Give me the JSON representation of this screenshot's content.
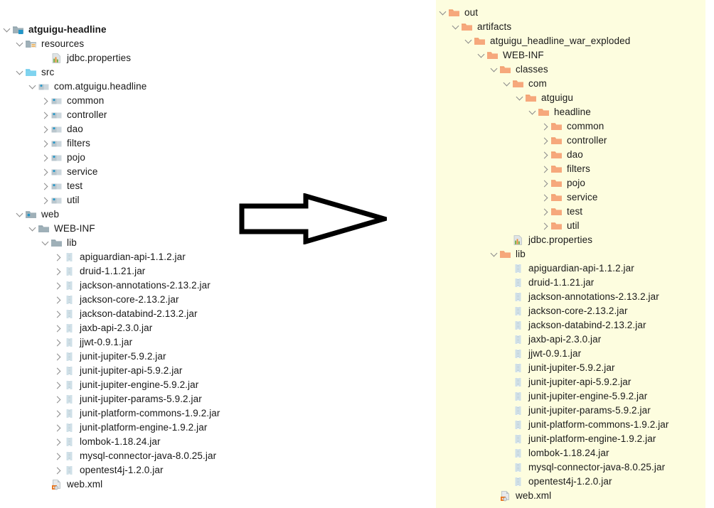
{
  "theme": {
    "left_background": "#ffffff",
    "right_background": "#fdfddf",
    "text_color": "#181818",
    "chevron_color": "#8a8a8a",
    "folder_blue": "#9aa7ad",
    "folder_cyan": "#7fd3ef",
    "folder_orange": "#f5a97a",
    "jar_icon_color": "#c6d9e2",
    "accent_blue": "#2196c9"
  },
  "arrow": {
    "name": "right-block-arrow",
    "stroke": "#000000",
    "fill": "#ffffff",
    "direction": "right"
  },
  "left_tree": {
    "name": "project-source-tree",
    "rows": [
      {
        "indent": 0,
        "chevron": "down",
        "icon": "module-icon",
        "label": "atguigu-headline",
        "bold": true
      },
      {
        "indent": 1,
        "chevron": "down",
        "icon": "resources-icon",
        "label": "resources",
        "bold": false
      },
      {
        "indent": 3,
        "chevron": "none",
        "icon": "properties-icon",
        "label": "jdbc.properties",
        "bold": false
      },
      {
        "indent": 1,
        "chevron": "down",
        "icon": "source-root-icon",
        "label": "src",
        "bold": false
      },
      {
        "indent": 2,
        "chevron": "down",
        "icon": "package-icon",
        "label": "com.atguigu.headline",
        "bold": false
      },
      {
        "indent": 3,
        "chevron": "right",
        "icon": "package-icon",
        "label": "common",
        "bold": false
      },
      {
        "indent": 3,
        "chevron": "right",
        "icon": "package-icon",
        "label": "controller",
        "bold": false
      },
      {
        "indent": 3,
        "chevron": "right",
        "icon": "package-icon",
        "label": "dao",
        "bold": false
      },
      {
        "indent": 3,
        "chevron": "right",
        "icon": "package-icon",
        "label": "filters",
        "bold": false
      },
      {
        "indent": 3,
        "chevron": "right",
        "icon": "package-icon",
        "label": "pojo",
        "bold": false
      },
      {
        "indent": 3,
        "chevron": "right",
        "icon": "package-icon",
        "label": "service",
        "bold": false
      },
      {
        "indent": 3,
        "chevron": "right",
        "icon": "package-icon",
        "label": "test",
        "bold": false
      },
      {
        "indent": 3,
        "chevron": "right",
        "icon": "package-icon",
        "label": "util",
        "bold": false
      },
      {
        "indent": 1,
        "chevron": "down",
        "icon": "web-root-icon",
        "label": "web",
        "bold": false
      },
      {
        "indent": 2,
        "chevron": "down",
        "icon": "folder-icon",
        "label": "WEB-INF",
        "bold": false
      },
      {
        "indent": 3,
        "chevron": "down",
        "icon": "folder-icon",
        "label": "lib",
        "bold": false
      },
      {
        "indent": 4,
        "chevron": "right",
        "icon": "jar-icon",
        "label": "apiguardian-api-1.1.2.jar",
        "bold": false
      },
      {
        "indent": 4,
        "chevron": "right",
        "icon": "jar-icon",
        "label": "druid-1.1.21.jar",
        "bold": false
      },
      {
        "indent": 4,
        "chevron": "right",
        "icon": "jar-icon",
        "label": "jackson-annotations-2.13.2.jar",
        "bold": false
      },
      {
        "indent": 4,
        "chevron": "right",
        "icon": "jar-icon",
        "label": "jackson-core-2.13.2.jar",
        "bold": false
      },
      {
        "indent": 4,
        "chevron": "right",
        "icon": "jar-icon",
        "label": "jackson-databind-2.13.2.jar",
        "bold": false
      },
      {
        "indent": 4,
        "chevron": "right",
        "icon": "jar-icon",
        "label": "jaxb-api-2.3.0.jar",
        "bold": false
      },
      {
        "indent": 4,
        "chevron": "right",
        "icon": "jar-icon",
        "label": "jjwt-0.9.1.jar",
        "bold": false
      },
      {
        "indent": 4,
        "chevron": "right",
        "icon": "jar-icon",
        "label": "junit-jupiter-5.9.2.jar",
        "bold": false
      },
      {
        "indent": 4,
        "chevron": "right",
        "icon": "jar-icon",
        "label": "junit-jupiter-api-5.9.2.jar",
        "bold": false
      },
      {
        "indent": 4,
        "chevron": "right",
        "icon": "jar-icon",
        "label": "junit-jupiter-engine-5.9.2.jar",
        "bold": false
      },
      {
        "indent": 4,
        "chevron": "right",
        "icon": "jar-icon",
        "label": "junit-jupiter-params-5.9.2.jar",
        "bold": false
      },
      {
        "indent": 4,
        "chevron": "right",
        "icon": "jar-icon",
        "label": "junit-platform-commons-1.9.2.jar",
        "bold": false
      },
      {
        "indent": 4,
        "chevron": "right",
        "icon": "jar-icon",
        "label": "junit-platform-engine-1.9.2.jar",
        "bold": false
      },
      {
        "indent": 4,
        "chevron": "right",
        "icon": "jar-icon",
        "label": "lombok-1.18.24.jar",
        "bold": false
      },
      {
        "indent": 4,
        "chevron": "right",
        "icon": "jar-icon",
        "label": "mysql-connector-java-8.0.25.jar",
        "bold": false
      },
      {
        "indent": 4,
        "chevron": "right",
        "icon": "jar-icon",
        "label": "opentest4j-1.2.0.jar",
        "bold": false
      },
      {
        "indent": 3,
        "chevron": "none",
        "icon": "xml-icon",
        "label": "web.xml",
        "bold": false
      }
    ]
  },
  "right_tree": {
    "name": "artifact-output-tree",
    "rows": [
      {
        "indent": 0,
        "chevron": "down",
        "icon": "folder-orange-icon",
        "label": "out"
      },
      {
        "indent": 1,
        "chevron": "down",
        "icon": "folder-orange-icon",
        "label": "artifacts"
      },
      {
        "indent": 2,
        "chevron": "down",
        "icon": "folder-orange-icon",
        "label": "atguigu_headline_war_exploded"
      },
      {
        "indent": 3,
        "chevron": "down",
        "icon": "folder-orange-icon",
        "label": "WEB-INF"
      },
      {
        "indent": 4,
        "chevron": "down",
        "icon": "folder-orange-icon",
        "label": "classes"
      },
      {
        "indent": 5,
        "chevron": "down",
        "icon": "folder-orange-icon",
        "label": "com"
      },
      {
        "indent": 6,
        "chevron": "down",
        "icon": "folder-orange-icon",
        "label": "atguigu"
      },
      {
        "indent": 7,
        "chevron": "down",
        "icon": "folder-orange-icon",
        "label": "headline"
      },
      {
        "indent": 8,
        "chevron": "right",
        "icon": "folder-orange-icon",
        "label": "common"
      },
      {
        "indent": 8,
        "chevron": "right",
        "icon": "folder-orange-icon",
        "label": "controller"
      },
      {
        "indent": 8,
        "chevron": "right",
        "icon": "folder-orange-icon",
        "label": "dao"
      },
      {
        "indent": 8,
        "chevron": "right",
        "icon": "folder-orange-icon",
        "label": "filters"
      },
      {
        "indent": 8,
        "chevron": "right",
        "icon": "folder-orange-icon",
        "label": "pojo"
      },
      {
        "indent": 8,
        "chevron": "right",
        "icon": "folder-orange-icon",
        "label": "service"
      },
      {
        "indent": 8,
        "chevron": "right",
        "icon": "folder-orange-icon",
        "label": "test"
      },
      {
        "indent": 8,
        "chevron": "right",
        "icon": "folder-orange-icon",
        "label": "util"
      },
      {
        "indent": 5,
        "chevron": "none",
        "icon": "properties-icon",
        "label": "jdbc.properties"
      },
      {
        "indent": 4,
        "chevron": "down",
        "icon": "folder-orange-icon",
        "label": "lib"
      },
      {
        "indent": 5,
        "chevron": "none",
        "icon": "jar-icon",
        "label": "apiguardian-api-1.1.2.jar"
      },
      {
        "indent": 5,
        "chevron": "none",
        "icon": "jar-icon",
        "label": "druid-1.1.21.jar"
      },
      {
        "indent": 5,
        "chevron": "none",
        "icon": "jar-icon",
        "label": "jackson-annotations-2.13.2.jar"
      },
      {
        "indent": 5,
        "chevron": "none",
        "icon": "jar-icon",
        "label": "jackson-core-2.13.2.jar"
      },
      {
        "indent": 5,
        "chevron": "none",
        "icon": "jar-icon",
        "label": "jackson-databind-2.13.2.jar"
      },
      {
        "indent": 5,
        "chevron": "none",
        "icon": "jar-icon",
        "label": "jaxb-api-2.3.0.jar"
      },
      {
        "indent": 5,
        "chevron": "none",
        "icon": "jar-icon",
        "label": "jjwt-0.9.1.jar"
      },
      {
        "indent": 5,
        "chevron": "none",
        "icon": "jar-icon",
        "label": "junit-jupiter-5.9.2.jar"
      },
      {
        "indent": 5,
        "chevron": "none",
        "icon": "jar-icon",
        "label": "junit-jupiter-api-5.9.2.jar"
      },
      {
        "indent": 5,
        "chevron": "none",
        "icon": "jar-icon",
        "label": "junit-jupiter-engine-5.9.2.jar"
      },
      {
        "indent": 5,
        "chevron": "none",
        "icon": "jar-icon",
        "label": "junit-jupiter-params-5.9.2.jar"
      },
      {
        "indent": 5,
        "chevron": "none",
        "icon": "jar-icon",
        "label": "junit-platform-commons-1.9.2.jar"
      },
      {
        "indent": 5,
        "chevron": "none",
        "icon": "jar-icon",
        "label": "junit-platform-engine-1.9.2.jar"
      },
      {
        "indent": 5,
        "chevron": "none",
        "icon": "jar-icon",
        "label": "lombok-1.18.24.jar"
      },
      {
        "indent": 5,
        "chevron": "none",
        "icon": "jar-icon",
        "label": "mysql-connector-java-8.0.25.jar"
      },
      {
        "indent": 5,
        "chevron": "none",
        "icon": "jar-icon",
        "label": "opentest4j-1.2.0.jar"
      },
      {
        "indent": 4,
        "chevron": "none",
        "icon": "xml-icon",
        "label": "web.xml"
      }
    ]
  }
}
